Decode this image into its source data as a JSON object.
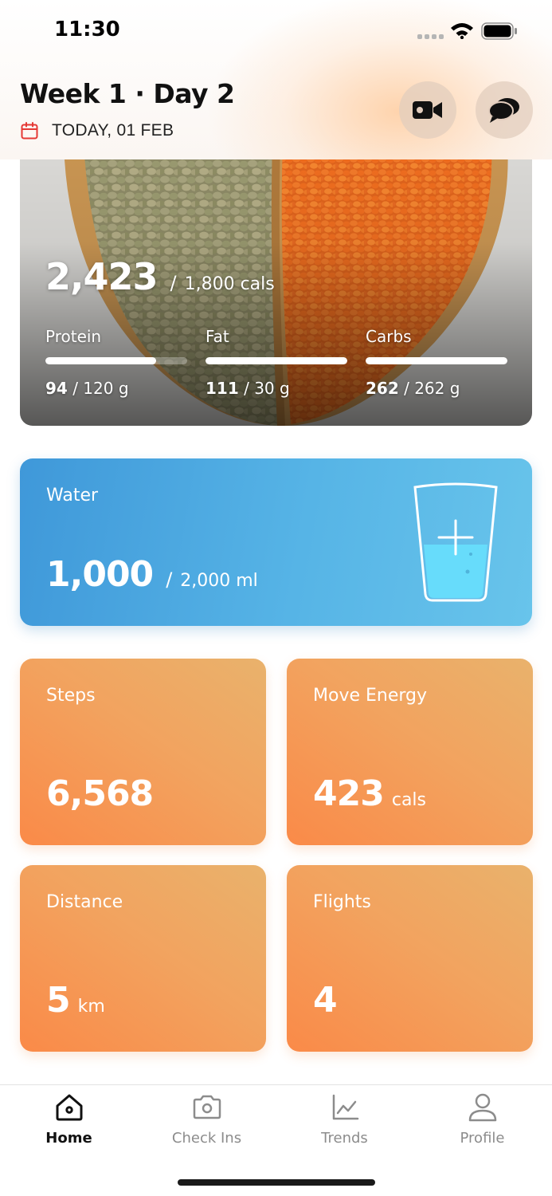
{
  "status_bar": {
    "time": "11:30"
  },
  "header": {
    "title": "Week 1 · Day 2",
    "date": "TODAY, 01 FEB",
    "icons": [
      "calendar-icon",
      "video-camera-icon",
      "chat-bubbles-icon"
    ]
  },
  "nutrition": {
    "calories": "2,423",
    "separator": "/",
    "calorie_target": "1,800 cals",
    "macros": [
      {
        "name": "Protein",
        "value": "94",
        "target": "/ 120 g",
        "progress": 0.78
      },
      {
        "name": "Fat",
        "value": "111",
        "target": "/ 30 g",
        "progress": 1.0
      },
      {
        "name": "Carbs",
        "value": "262",
        "target": "/ 262 g",
        "progress": 1.0
      }
    ]
  },
  "water": {
    "title": "Water",
    "value": "1,000",
    "separator": "/",
    "target": "2,000 ml",
    "progress": 0.5
  },
  "activity": {
    "steps": {
      "label": "Steps",
      "value": "6,568",
      "unit": ""
    },
    "move_energy": {
      "label": "Move Energy",
      "value": "423",
      "unit": "cals"
    },
    "distance": {
      "label": "Distance",
      "value": "5",
      "unit": "km"
    },
    "flights": {
      "label": "Flights",
      "value": "4",
      "unit": ""
    }
  },
  "tabs": [
    {
      "label": "Home",
      "icon": "home-icon",
      "active": true
    },
    {
      "label": "Check Ins",
      "icon": "camera-icon",
      "active": false
    },
    {
      "label": "Trends",
      "icon": "chart-icon",
      "active": false
    },
    {
      "label": "Profile",
      "icon": "user-icon",
      "active": false
    }
  ],
  "colors": {
    "accent_red": "#e53935",
    "water_blue": "#3f98d9",
    "tile_orange": "#fa8a48"
  }
}
